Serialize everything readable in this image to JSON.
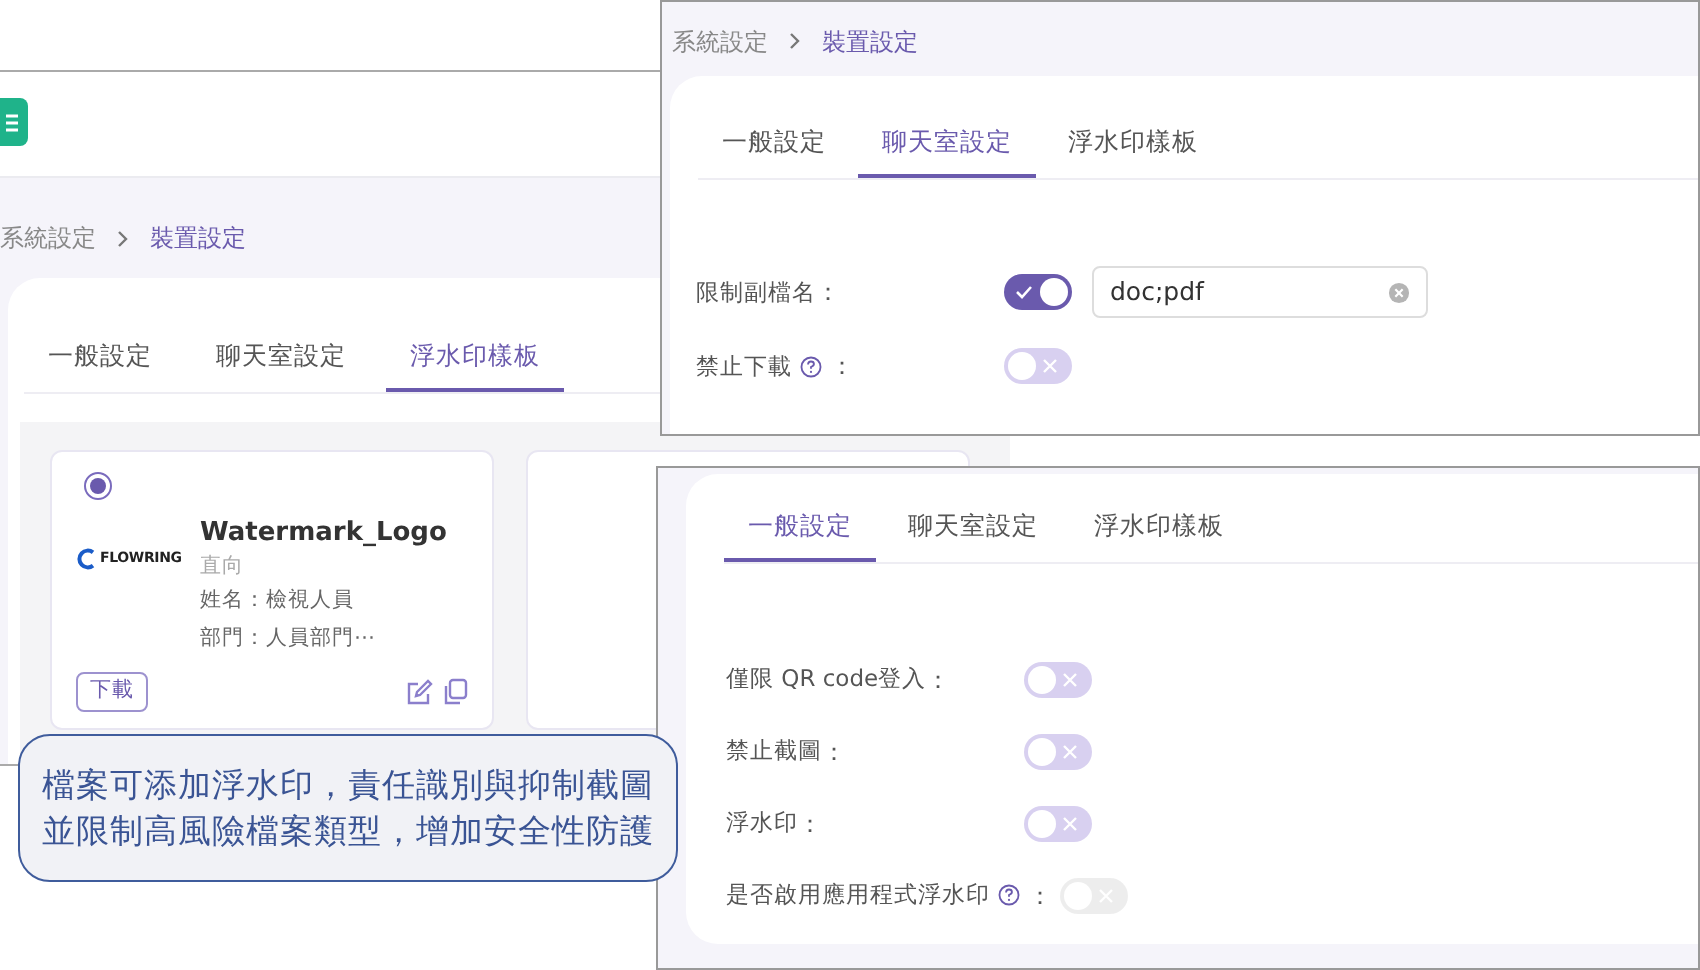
{
  "back_screen": {
    "breadcrumb": [
      "系統設定",
      "裝置設定"
    ],
    "tabs": [
      {
        "label": "一般設定",
        "selected": false
      },
      {
        "label": "聊天室設定",
        "selected": false
      },
      {
        "label": "浮水印樣板",
        "selected": true
      }
    ],
    "watermark_cards": [
      {
        "selected": true,
        "logo_text": "FLOWRING",
        "title": "Watermark_Logo",
        "orientation": "直向",
        "lines": [
          "姓名：檢視人員",
          "部門：人員部門⋯"
        ],
        "download": "下載"
      }
    ]
  },
  "chat_screen": {
    "breadcrumb": [
      "系統設定",
      "裝置設定"
    ],
    "tabs": [
      {
        "label": "一般設定",
        "selected": false
      },
      {
        "label": "聊天室設定",
        "selected": true
      },
      {
        "label": "浮水印樣板",
        "selected": false
      }
    ],
    "rows": [
      {
        "label": "限制副檔名",
        "help": false,
        "colon": "：",
        "on": true,
        "disabled": false,
        "value": "doc;pdf"
      },
      {
        "label": "禁止下載",
        "help": true,
        "colon": "：",
        "on": false,
        "disabled": false
      }
    ]
  },
  "general_screen": {
    "tabs": [
      {
        "label": "一般設定",
        "selected": true
      },
      {
        "label": "聊天室設定",
        "selected": false
      },
      {
        "label": "浮水印樣板",
        "selected": false
      }
    ],
    "rows": [
      {
        "label": "僅限 QR code登入",
        "help": false,
        "colon": "：",
        "on": false,
        "disabled": false
      },
      {
        "label": "禁止截圖",
        "help": false,
        "colon": "：",
        "on": false,
        "disabled": false
      },
      {
        "label": "浮水印",
        "help": false,
        "colon": "：",
        "on": false,
        "disabled": false
      },
      {
        "label": "是否啟用應用程式浮水印",
        "help": true,
        "colon": "：",
        "on": false,
        "disabled": true
      }
    ]
  },
  "callout": {
    "lines": [
      "檔案可添加浮水印，責任識別與抑制截圖",
      "並限制高風險檔案類型，增加安全性防護"
    ]
  }
}
